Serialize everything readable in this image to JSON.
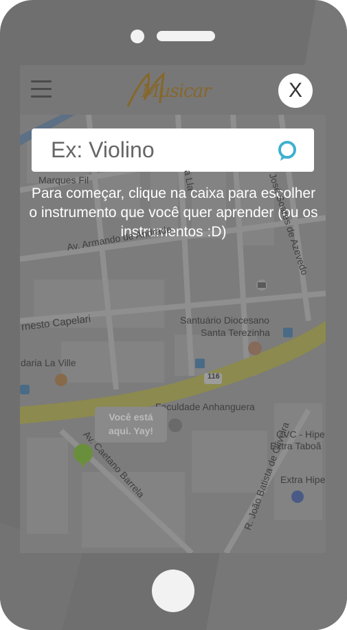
{
  "app": {
    "logo_text": "Musicar",
    "close_label": "X"
  },
  "search": {
    "placeholder": "Ex: Violino"
  },
  "instructions": "Para começar, clique na caixa para escolher o instrumento que você quer aprender (ou os instrumentos :D)",
  "map": {
    "labels": {
      "marques": "Marques Fil",
      "armando": "Av. Armando de Andrade",
      "ernesto": "rnesto Capelari",
      "santuario1": "Santuário Diocesano",
      "santuario2": "Santa Terezinha",
      "laville": "daria La Ville",
      "route": "116",
      "faculdade": "Faculdade Anhanguera",
      "caetano": "Av. Caetano Barrela",
      "joao": "R. João Batista de Oliveira",
      "cvc1": "CVC - Hipe",
      "cvc2": "Extra Taboã",
      "extra": "Extra Hipe",
      "jose": "José Soares de Azevedo",
      "lla": "a Lla"
    },
    "you_are_here": [
      "Você está",
      "aqui. Yay!"
    ]
  },
  "colors": {
    "logo": "#86672a",
    "chat_icon": "#3fb0d0",
    "pin": "#6a8f3c",
    "road_major": "#8c8a4e"
  }
}
